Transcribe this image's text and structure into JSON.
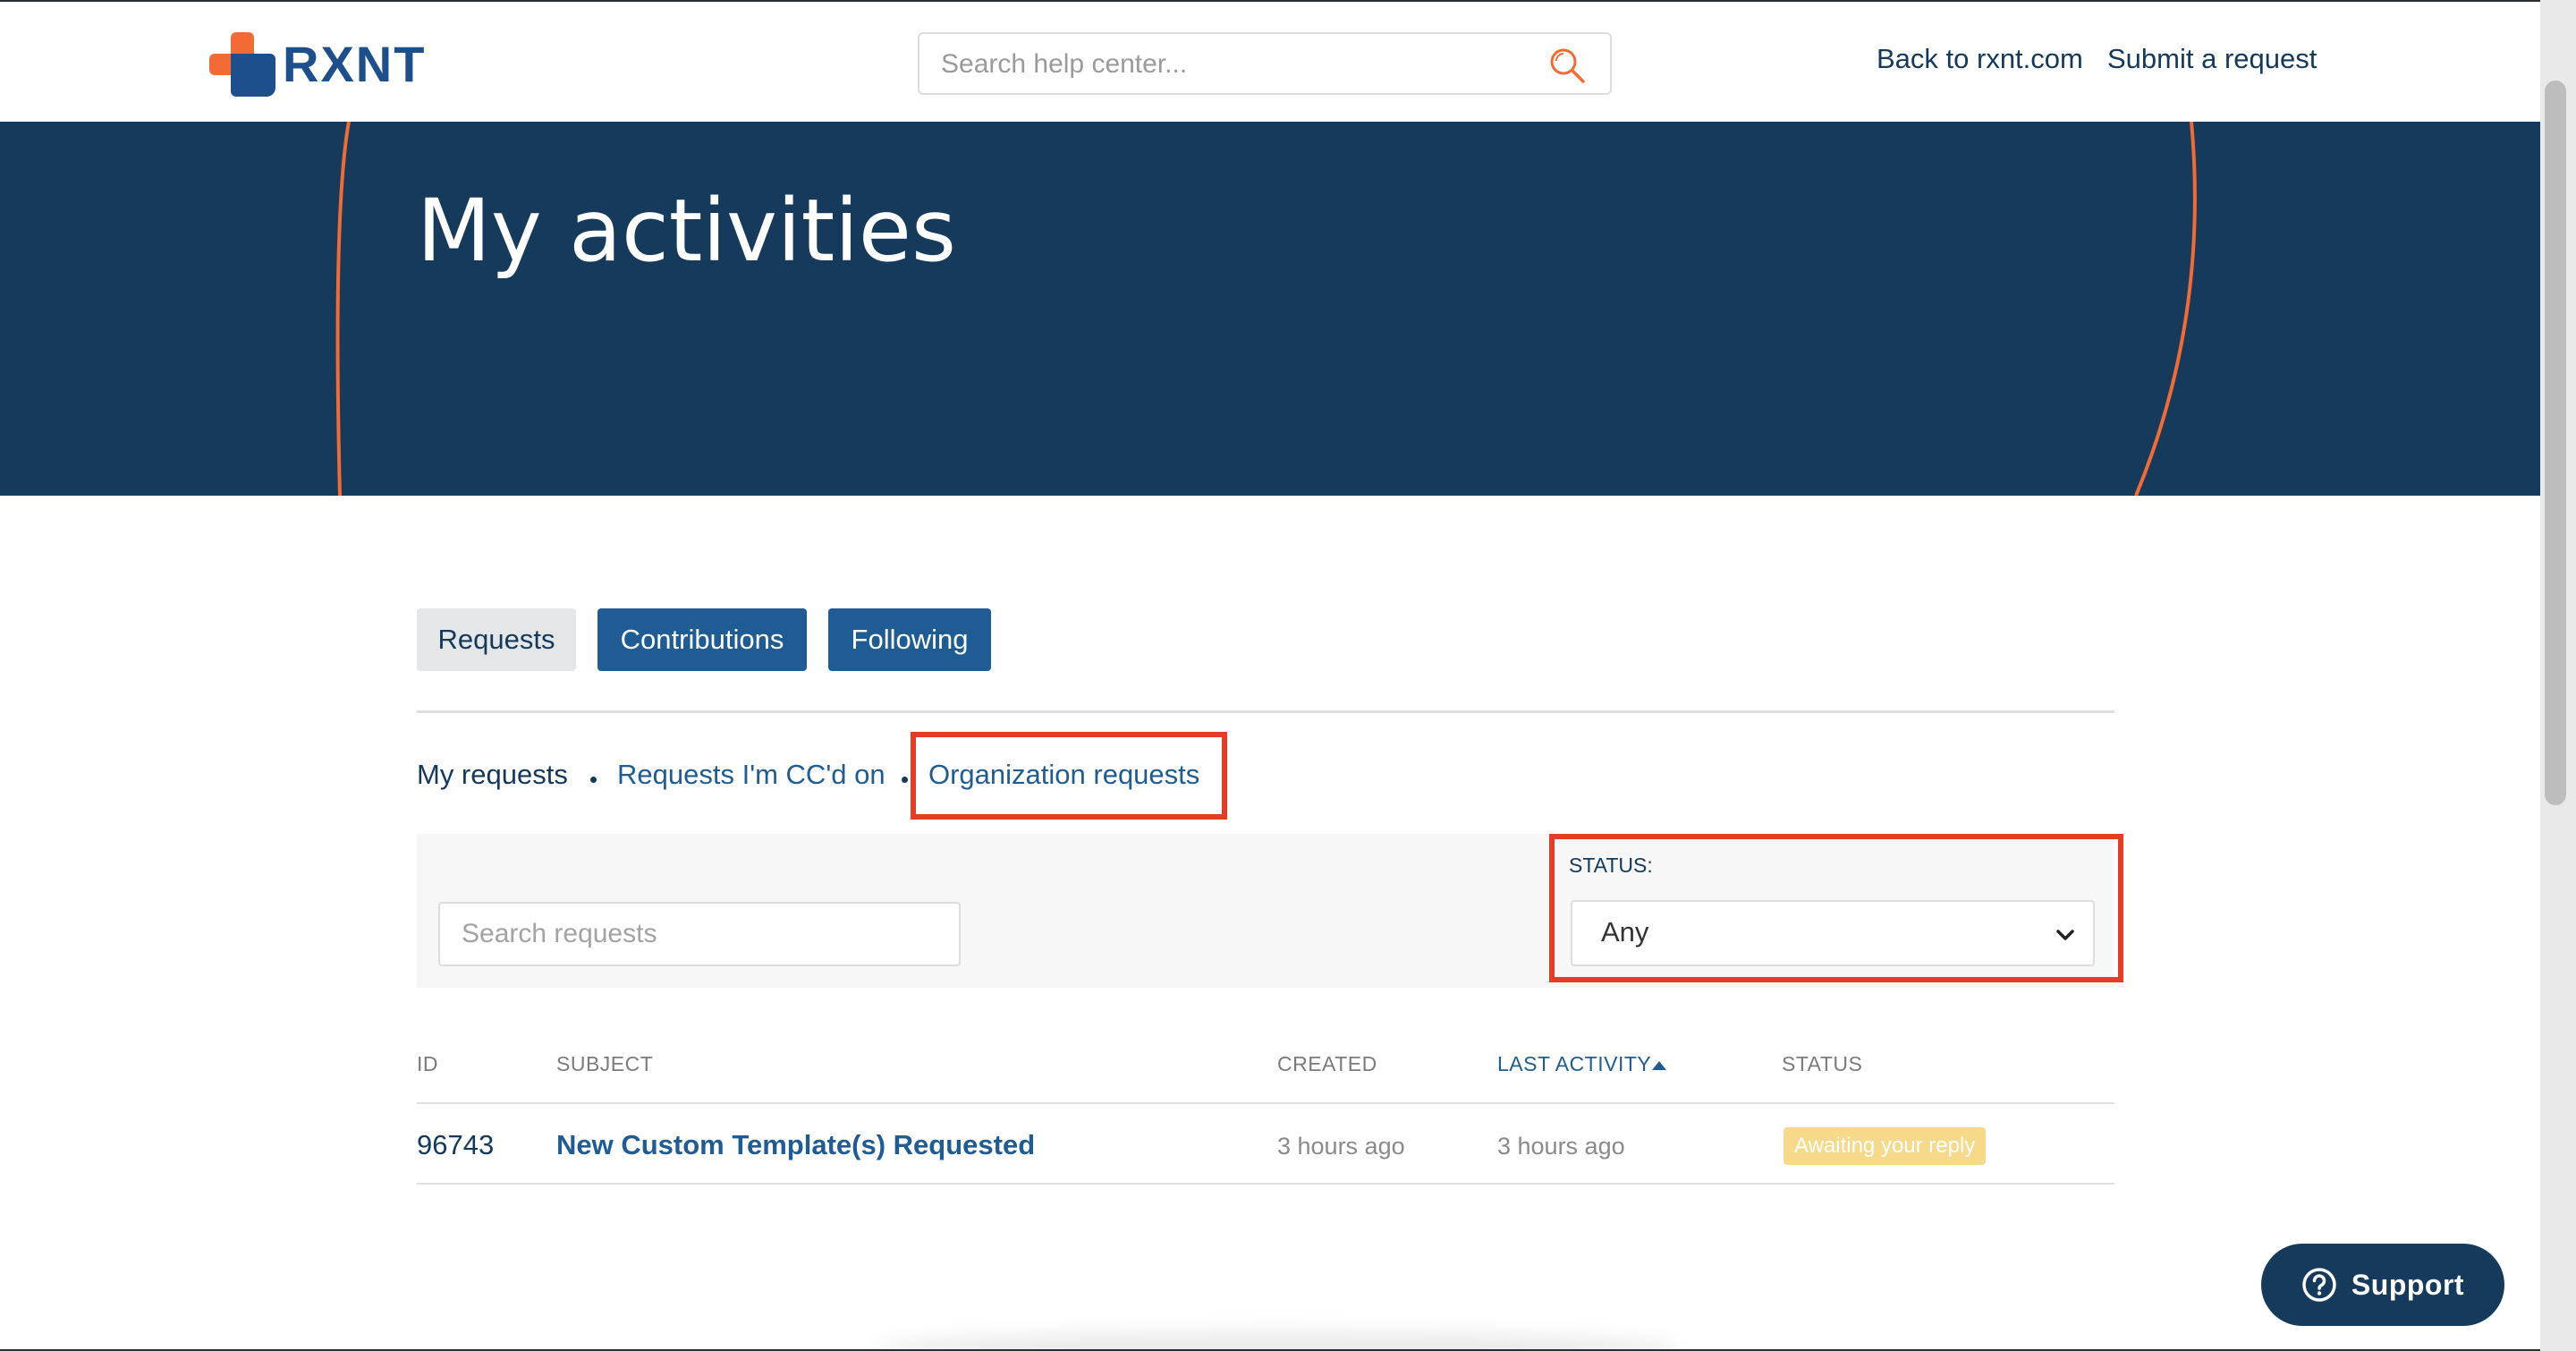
{
  "header": {
    "logo_text": "RXNT",
    "search_placeholder": "Search help center...",
    "links": [
      "Back to rxnt.com",
      "Submit a request"
    ]
  },
  "hero": {
    "title": "My activities"
  },
  "tabs": [
    {
      "label": "Requests",
      "active": true
    },
    {
      "label": "Contributions",
      "active": false
    },
    {
      "label": "Following",
      "active": false
    }
  ],
  "subnav": {
    "current": "My requests",
    "links": [
      "Requests I'm CC'd on",
      "Organization requests"
    ]
  },
  "filters": {
    "search_placeholder": "Search requests",
    "status_label": "STATUS:",
    "status_value": "Any"
  },
  "table": {
    "columns": [
      "ID",
      "SUBJECT",
      "CREATED",
      "LAST ACTIVITY",
      "STATUS"
    ],
    "sorted_column": "LAST ACTIVITY",
    "rows": [
      {
        "id": "96743",
        "subject": "New Custom Template(s) Requested",
        "created": "3 hours ago",
        "last_activity": "3 hours ago",
        "status": "Awaiting your reply"
      }
    ]
  },
  "support_button": {
    "label": "Support"
  },
  "colors": {
    "navy": "#153a5b",
    "blue": "#1f5c93",
    "orange": "#f26b35",
    "highlight": "#e53c27",
    "badge": "#f7d98a"
  }
}
